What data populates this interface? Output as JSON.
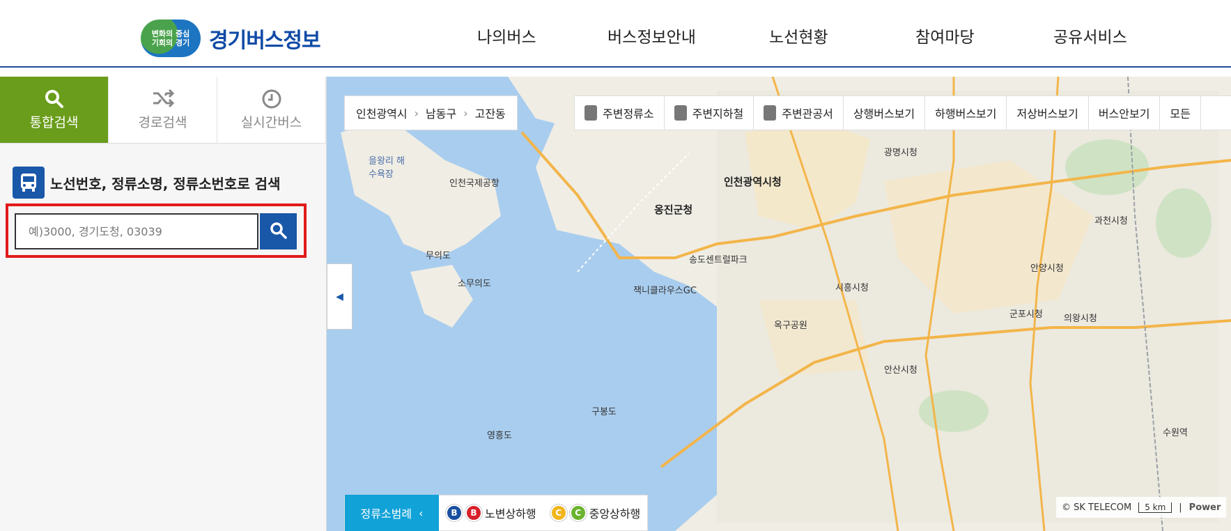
{
  "header": {
    "logo_badge_line1": "변화의 중심",
    "logo_badge_line2": "기회의 경기",
    "logo_text": "경기버스정보",
    "nav": [
      "나의버스",
      "버스정보안내",
      "노선현황",
      "참여마당",
      "공유서비스"
    ]
  },
  "sidebar": {
    "tabs": [
      {
        "label": "통합검색",
        "icon": "search-icon",
        "active": true
      },
      {
        "label": "경로검색",
        "icon": "shuffle-icon",
        "active": false
      },
      {
        "label": "실시간버스",
        "icon": "clock-icon",
        "active": false
      }
    ],
    "search_title": "노선번호, 정류소명, 정류소번호로 검색",
    "search_placeholder": "예)3000, 경기도청, 03039"
  },
  "map": {
    "breadcrumb": [
      "인천광역시",
      "남동구",
      "고잔동"
    ],
    "toolbar": [
      {
        "label": "주변정류소",
        "icon": "bus-stop-icon"
      },
      {
        "label": "주변지하철",
        "icon": "subway-icon"
      },
      {
        "label": "주변관공서",
        "icon": "building-icon"
      },
      {
        "label": "상행버스보기",
        "icon": ""
      },
      {
        "label": "하행버스보기",
        "icon": ""
      },
      {
        "label": "저상버스보기",
        "icon": ""
      },
      {
        "label": "버스안보기",
        "icon": ""
      },
      {
        "label": "모든",
        "icon": ""
      }
    ],
    "legend_button": "정류소범례",
    "legend_items": [
      {
        "badges": [
          "B",
          "B"
        ],
        "colors": [
          "#1a4fa0",
          "#d8202b"
        ],
        "label": "노변상하행"
      },
      {
        "badges": [
          "C",
          "C"
        ],
        "colors": [
          "#f2b51c",
          "#6ab42e"
        ],
        "label": "중앙상하행"
      }
    ],
    "copyright": "© SK TELECOM",
    "scale": "5 km",
    "powered": "Power",
    "labels": [
      {
        "text": "인천광역시청",
        "big": true
      },
      {
        "text": "옹진군청",
        "big": true
      },
      {
        "text": "광명시청",
        "big": false
      },
      {
        "text": "시흥시청",
        "big": false
      },
      {
        "text": "안산시청",
        "big": false
      },
      {
        "text": "군포시청",
        "big": false
      },
      {
        "text": "안양시청",
        "big": false
      },
      {
        "text": "과천시청",
        "big": false
      },
      {
        "text": "의왕시청",
        "big": false
      },
      {
        "text": "인천국제공항",
        "big": false
      },
      {
        "text": "을왕리 해수욕장",
        "big": false
      },
      {
        "text": "무의도",
        "big": false
      },
      {
        "text": "소무의도",
        "big": false
      },
      {
        "text": "잭니클라우스GC",
        "big": false
      },
      {
        "text": "송도센트럴파크",
        "big": false
      },
      {
        "text": "옥구공원",
        "big": false
      },
      {
        "text": "구봉도",
        "big": false
      },
      {
        "text": "영흥도",
        "big": false
      },
      {
        "text": "수원역",
        "big": false
      }
    ]
  },
  "colors": {
    "nav_border": "#1f4d9a",
    "active_tab": "#6a9d1b",
    "search_button": "#1957a8",
    "highlight": "#e21b1b",
    "legend_button": "#11a2d8",
    "water": "#a9cdee",
    "land": "#f0ede5"
  }
}
